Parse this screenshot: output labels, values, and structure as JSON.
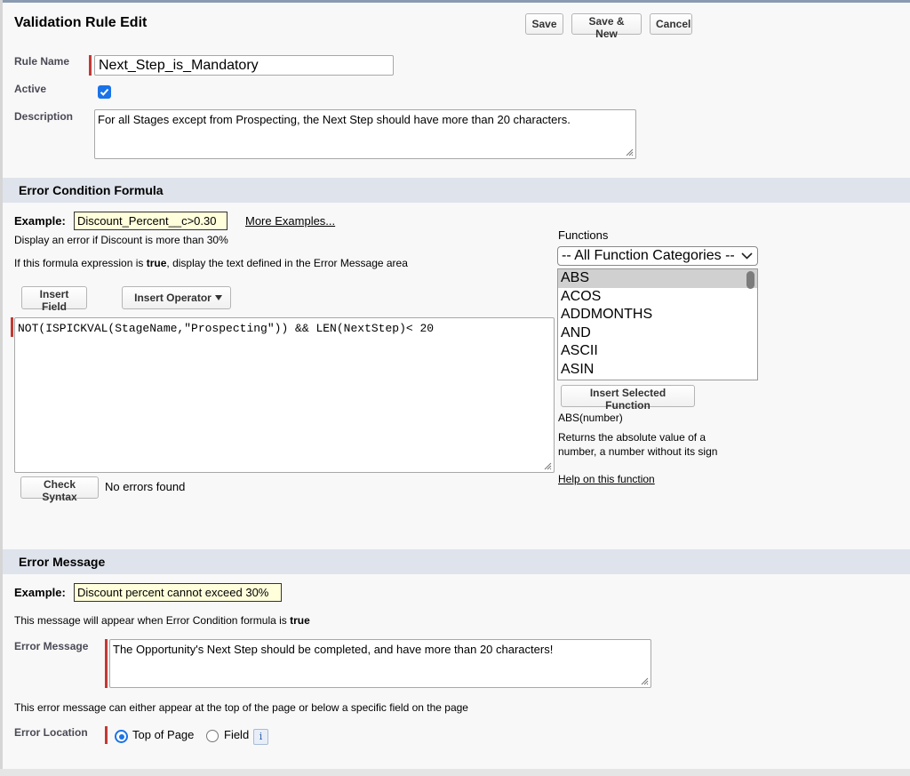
{
  "header": {
    "title": "Validation Rule Edit",
    "save_label": "Save",
    "save_new_label": "Save & New",
    "cancel_label": "Cancel"
  },
  "rule": {
    "name_label": "Rule Name",
    "name_value": "Next_Step_is_Mandatory",
    "active_label": "Active",
    "active_checked": true,
    "description_label": "Description",
    "description_value": "For all Stages except from Prospecting, the Next Step should have more than 20 characters."
  },
  "formula_section": {
    "heading": "Error Condition Formula",
    "example_label": "Example:",
    "example_value": "Discount_Percent__c>0.30",
    "more_examples_link": "More Examples...",
    "example_desc": "Display an error if Discount is more than 30%",
    "instruction_prefix": "If this formula expression is ",
    "instruction_bold": "true",
    "instruction_suffix": ", display the text defined in the Error Message area",
    "insert_field_label": "Insert Field",
    "insert_operator_label": "Insert Operator",
    "formula_value": "NOT(ISPICKVAL(StageName,\"Prospecting\")) && LEN(NextStep)< 20",
    "check_syntax_label": "Check Syntax",
    "syntax_status": "No errors found"
  },
  "functions": {
    "label": "Functions",
    "category_selected": "-- All Function Categories --",
    "items": [
      "ABS",
      "ACOS",
      "ADDMONTHS",
      "AND",
      "ASCII",
      "ASIN"
    ],
    "selected_item": "ABS",
    "insert_button_label": "Insert Selected Function",
    "signature": "ABS(number)",
    "description": "Returns the absolute value of a number, a number without its sign",
    "help_link": "Help on this function"
  },
  "message_section": {
    "heading": "Error Message",
    "example_label": "Example:",
    "example_value": "Discount percent cannot exceed 30%",
    "appear_prefix": "This message will appear when Error Condition formula is ",
    "appear_bold": "true",
    "error_message_label": "Error Message",
    "error_message_value": "The Opportunity's Next Step should be completed, and have more than 20 characters!",
    "location_note": "This error message can either appear at the top of the page or below a specific field on the page",
    "location_label": "Error Location",
    "option_top": "Top of Page",
    "option_field": "Field",
    "selected_location": "Top of Page",
    "info_icon": "i"
  },
  "colors": {
    "required_bar": "#c23934",
    "section_bg": "#dfe3ec",
    "example_bg": "#ffffdc",
    "accent": "#1a73e8"
  }
}
